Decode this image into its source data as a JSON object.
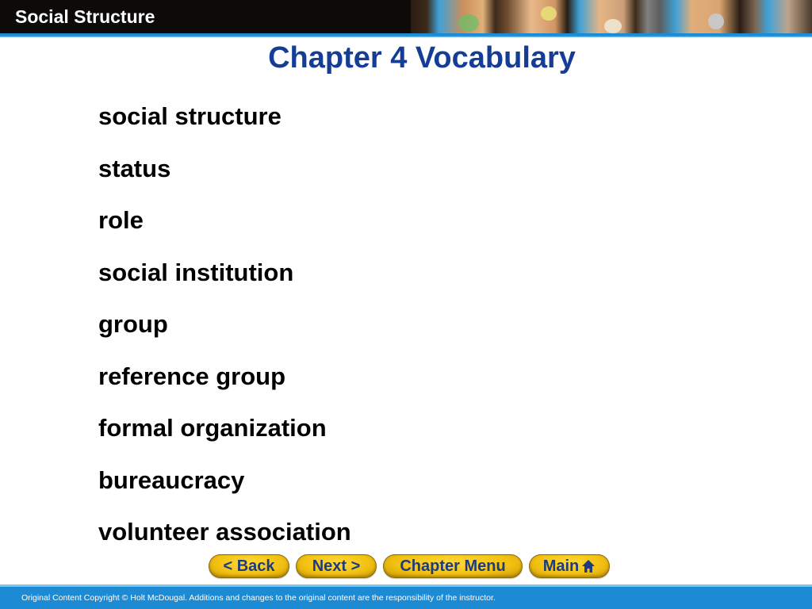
{
  "header": {
    "title": "Social Structure",
    "banner_image": "collage-of-faces-banner"
  },
  "page_title": "Chapter 4 Vocabulary",
  "vocabulary": [
    "social structure",
    "status",
    "role",
    "social institution",
    "group",
    "reference group",
    "formal organization",
    "bureaucracy",
    "volunteer association"
  ],
  "nav": {
    "back_label": "< Back",
    "next_label": "Next >",
    "chapter_menu_label": "Chapter Menu",
    "main_label": "Main",
    "main_icon": "home-icon"
  },
  "footer": {
    "copyright": "Original Content Copyright © Holt McDougal. Additions and changes to the original content are the responsibility of the instructor."
  },
  "colors": {
    "title_blue": "#163d96",
    "header_black": "#0d0b0a",
    "accent_blue": "#1d8ad4",
    "button_gold": "#f2c010",
    "button_text": "#1f3b7a"
  }
}
